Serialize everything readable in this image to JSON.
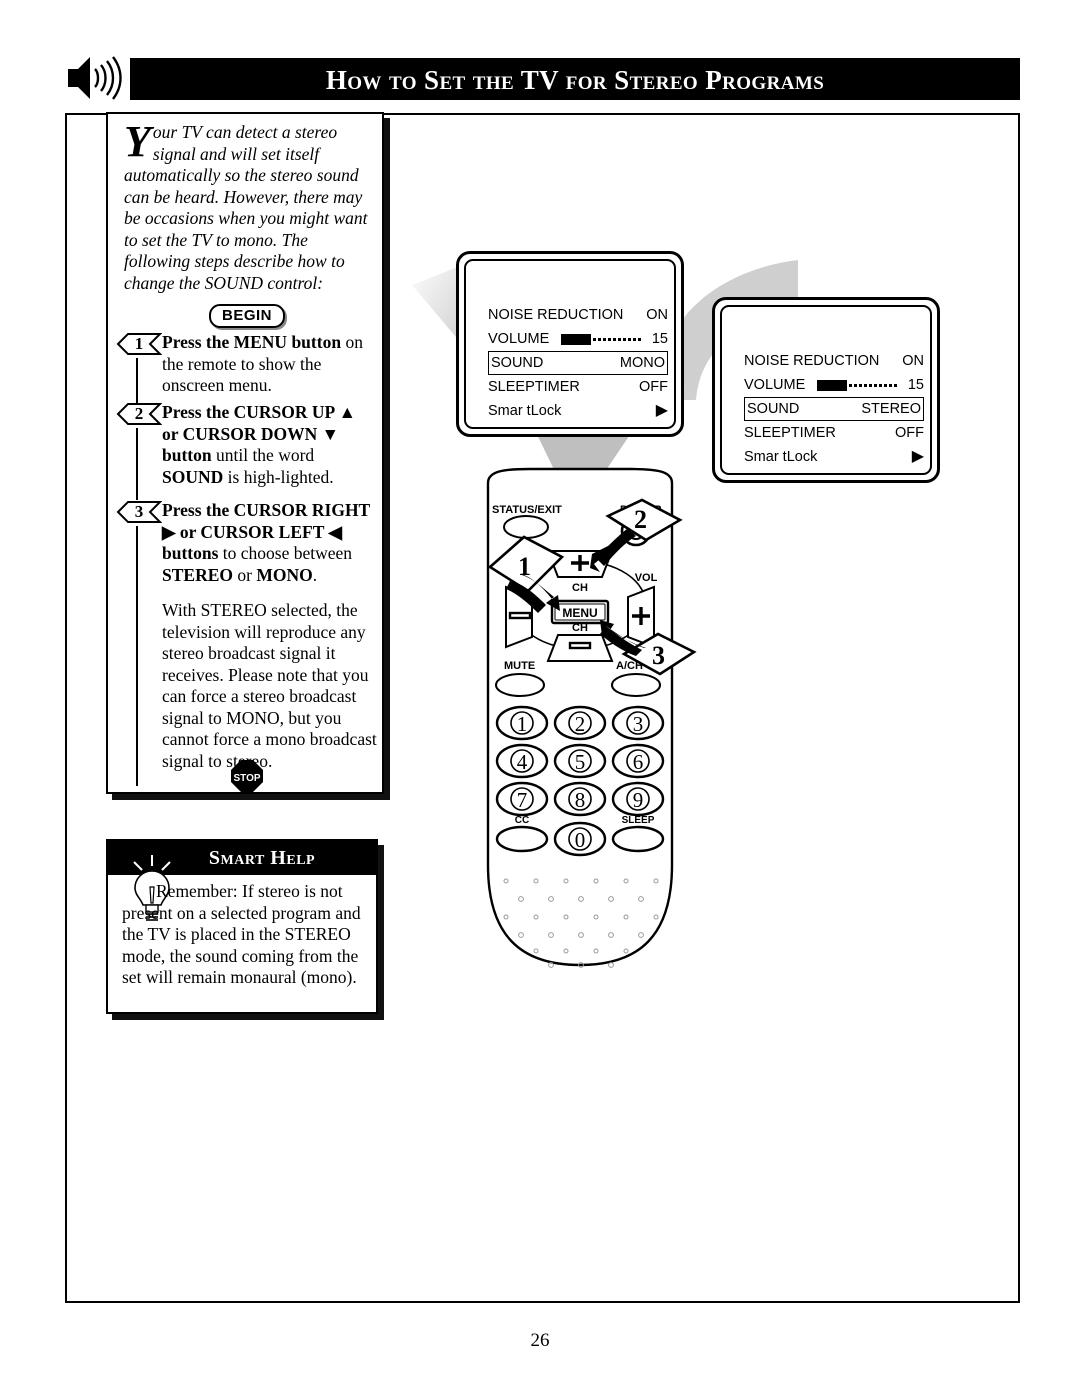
{
  "header": {
    "title": "How to Set the TV for Stereo Programs",
    "icon": "speaker-sound-icon"
  },
  "intro": {
    "dropcap": "Y",
    "text": "our TV can detect a stereo signal and will set itself automatically so the stereo sound can be heard. However, there may be occasions when you might want to set the TV to mono. The following steps describe how to change the SOUND control:"
  },
  "begin_label": "BEGIN",
  "stop_label": "STOP",
  "steps": [
    {
      "number": "1",
      "html": "<b>Press the MENU button</b> on the remote to show the onscreen menu."
    },
    {
      "number": "2",
      "html": "<b>Press the CURSOR UP ▲ or CURSOR DOWN ▼ button</b> until the word <b>SOUND</b> is high-lighted."
    },
    {
      "number": "3",
      "html": "<b>Press the CURSOR RIGHT ▶ or CURSOR LEFT ◀ buttons</b> to choose between <b>STEREO</b> or <b>MONO</b>."
    }
  ],
  "paragraph": "With STEREO selected, the television will reproduce any stereo broadcast signal it receives. Please note that you can force a stereo broadcast signal to MONO, but you cannot force a mono broadcast signal to stereo.",
  "smart_help": {
    "title": "Smart Help",
    "icon": "lightbulb-icon",
    "body": "Remember: If stereo is not present on a selected program and the TV is placed in the STEREO mode, the sound coming from the set will remain monaural (mono)."
  },
  "tv_menus": [
    {
      "id": "menu-mono",
      "rows": [
        {
          "label": "NOISE REDUCTION",
          "value": "ON",
          "type": "text",
          "highlighted": false
        },
        {
          "label": "VOLUME",
          "value": "15",
          "type": "slider",
          "highlighted": false
        },
        {
          "label": "SOUND",
          "value": "MONO",
          "type": "text",
          "highlighted": true
        },
        {
          "label": "SLEEPTIMER",
          "value": "OFF",
          "type": "text",
          "highlighted": false
        },
        {
          "label": "Smar tLock",
          "value": "▶",
          "type": "arrow",
          "highlighted": false
        }
      ]
    },
    {
      "id": "menu-stereo",
      "rows": [
        {
          "label": "NOISE REDUCTION",
          "value": "ON",
          "type": "text",
          "highlighted": false
        },
        {
          "label": "VOLUME",
          "value": "15",
          "type": "slider",
          "highlighted": false
        },
        {
          "label": "SOUND",
          "value": "STEREO",
          "type": "text",
          "highlighted": true
        },
        {
          "label": "SLEEPTIMER",
          "value": "OFF",
          "type": "text",
          "highlighted": false
        },
        {
          "label": "Smar tLock",
          "value": "▶",
          "type": "arrow",
          "highlighted": false
        }
      ]
    }
  ],
  "remote": {
    "labels": {
      "status_exit": "STATUS/EXIT",
      "power": "POWER",
      "ch_up": "CH",
      "ch_down": "CH",
      "vol": "VOL",
      "menu": "MENU",
      "mute": "MUTE",
      "a_ch": "A/CH",
      "cc": "CC",
      "sleep": "SLEEP"
    },
    "keypad": [
      "1",
      "2",
      "3",
      "4",
      "5",
      "6",
      "7",
      "8",
      "9",
      "0"
    ],
    "callouts": [
      "1",
      "2",
      "3"
    ]
  },
  "page_number": "26",
  "colors": {
    "ink": "#000000",
    "paper": "#ffffff",
    "gray_arrow": "#cfcfcf"
  }
}
